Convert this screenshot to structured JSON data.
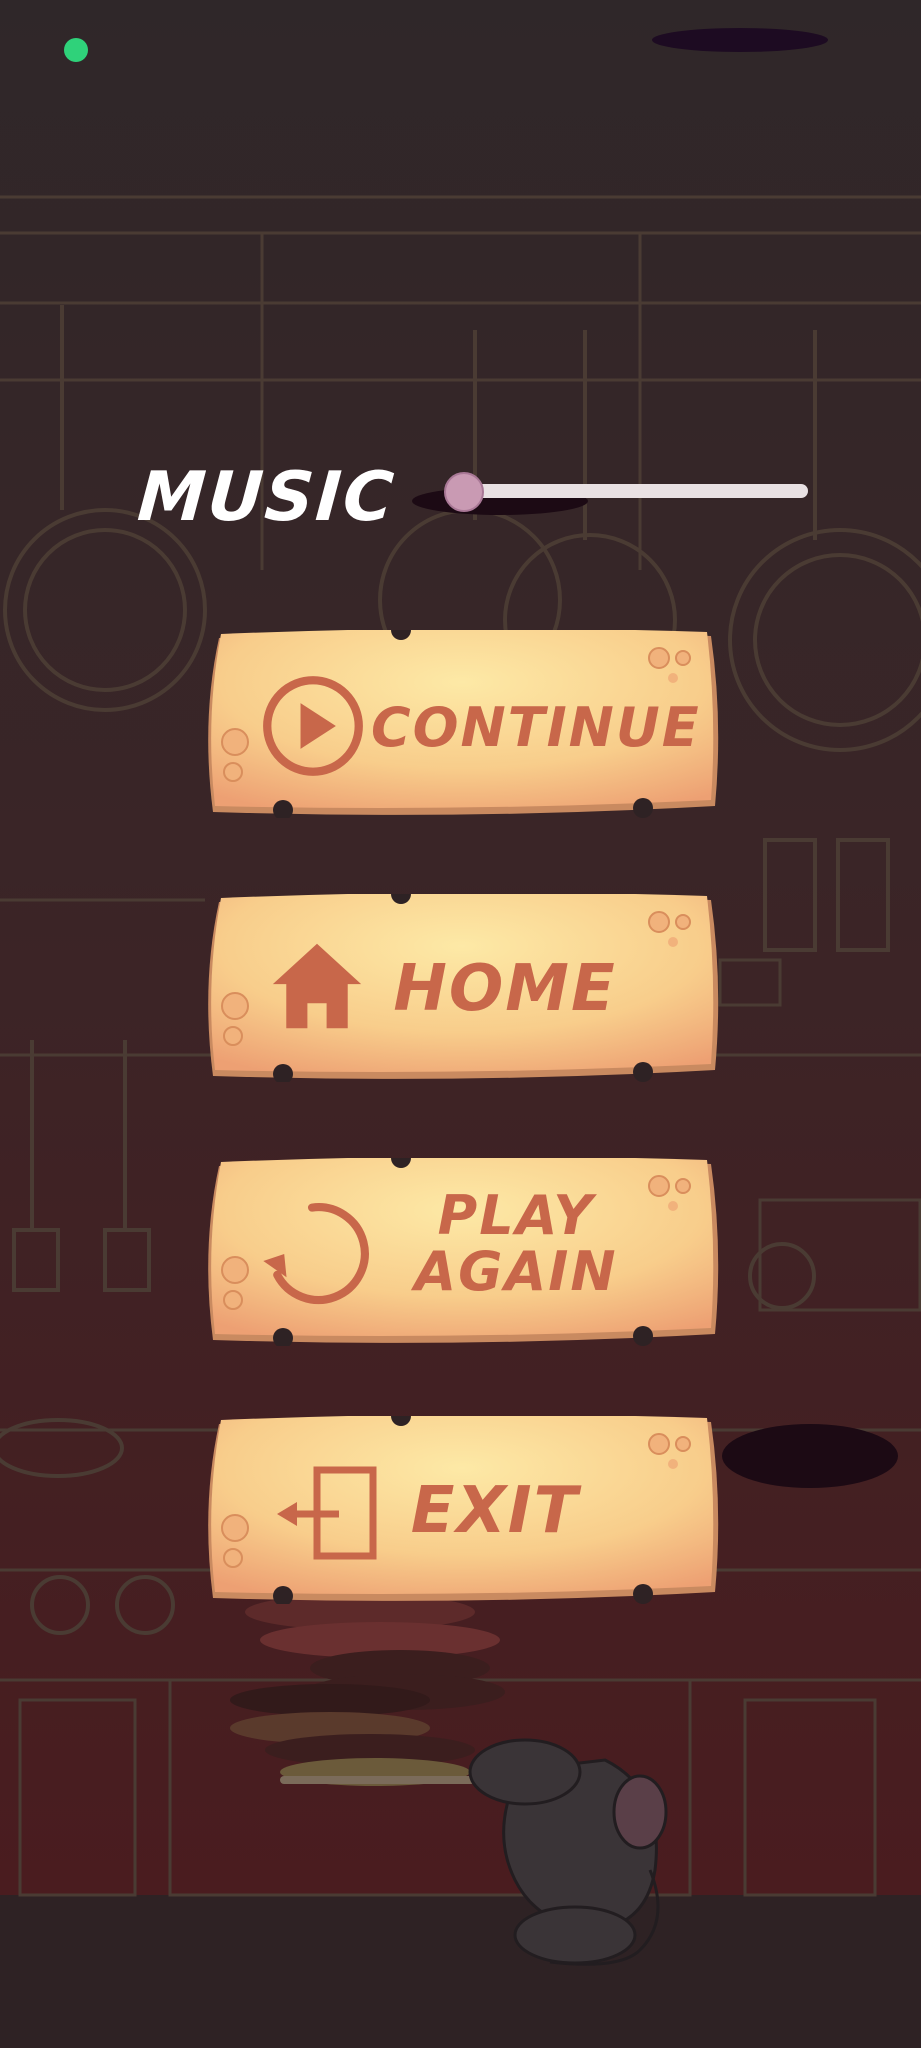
{
  "settings": {
    "music_label": "MUSIC",
    "music_level": 0.0
  },
  "menu": {
    "continue_label": "CONTINUE",
    "home_label": "HOME",
    "play_again_line1": "PLAY",
    "play_again_line2": "AGAIN",
    "exit_label": "EXIT"
  },
  "icons": {
    "continue": "play-icon",
    "home": "home-icon",
    "play_again": "restart-icon",
    "exit": "exit-icon"
  },
  "colors": {
    "plank_light": "#fce8a6",
    "plank_dark": "#eda073",
    "text_accent": "#c8674a",
    "status_dot": "#2fd27a",
    "slider_thumb": "#c99ab3"
  }
}
